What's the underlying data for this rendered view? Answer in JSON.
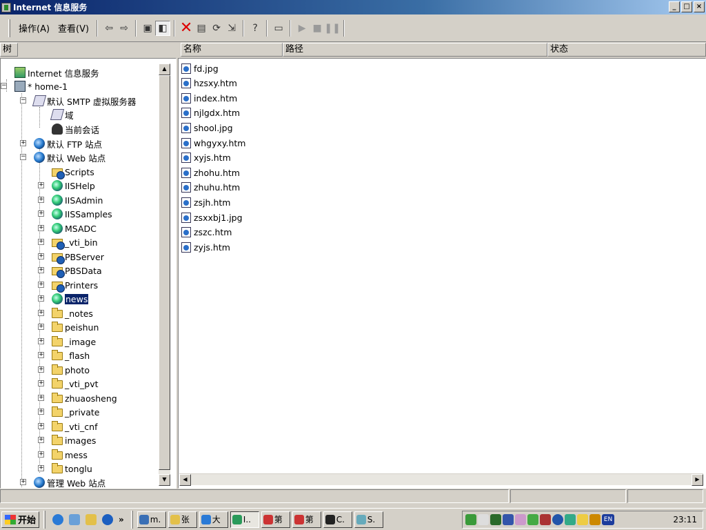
{
  "window": {
    "title": "Internet 信息服务",
    "controls": [
      "_",
      "□",
      "×"
    ]
  },
  "toolbar": {
    "menu_action": "操作(A)",
    "menu_view": "查看(V)"
  },
  "tree": {
    "header": "树",
    "nodes": [
      {
        "label": "Internet 信息服务",
        "icon": "iis-icon"
      },
      {
        "label": "* home-1",
        "icon": "computer-icon"
      },
      {
        "label": "默认 SMTP 虚拟服务器",
        "icon": "smtp-icon"
      },
      {
        "label": "域",
        "icon": "domain-icon"
      },
      {
        "label": "当前会话",
        "icon": "session-icon"
      },
      {
        "label": "默认 FTP 站点",
        "icon": "ftp-icon"
      },
      {
        "label": "默认 Web 站点",
        "icon": "web-site-icon"
      },
      {
        "label": "Scripts",
        "icon": "virtual-folder-icon"
      },
      {
        "label": "IISHelp",
        "icon": "app-icon"
      },
      {
        "label": "IISAdmin",
        "icon": "app-icon"
      },
      {
        "label": "IISSamples",
        "icon": "app-icon"
      },
      {
        "label": "MSADC",
        "icon": "app-icon"
      },
      {
        "label": "_vti_bin",
        "icon": "virtual-folder-icon"
      },
      {
        "label": "PBServer",
        "icon": "virtual-folder-icon"
      },
      {
        "label": "PBSData",
        "icon": "virtual-folder-icon"
      },
      {
        "label": "Printers",
        "icon": "virtual-folder-icon"
      },
      {
        "label": "news",
        "icon": "app-icon",
        "selected": true
      },
      {
        "label": "_notes",
        "icon": "folder-icon"
      },
      {
        "label": "peishun",
        "icon": "folder-icon"
      },
      {
        "label": "_image",
        "icon": "folder-icon"
      },
      {
        "label": "_flash",
        "icon": "folder-icon"
      },
      {
        "label": "photo",
        "icon": "folder-icon"
      },
      {
        "label": "_vti_pvt",
        "icon": "folder-icon"
      },
      {
        "label": "zhuaosheng",
        "icon": "folder-icon"
      },
      {
        "label": "_private",
        "icon": "folder-icon"
      },
      {
        "label": "_vti_cnf",
        "icon": "folder-icon"
      },
      {
        "label": "images",
        "icon": "folder-icon"
      },
      {
        "label": "mess",
        "icon": "folder-icon"
      },
      {
        "label": "tonglu",
        "icon": "folder-icon"
      },
      {
        "label": "管理 Web 站点",
        "icon": "web-site-icon"
      }
    ]
  },
  "list": {
    "columns": [
      "名称",
      "路径",
      "状态"
    ],
    "files": [
      "fd.jpg",
      "hzsxy.htm",
      "index.htm",
      "njlgdx.htm",
      "shool.jpg",
      "whgyxy.htm",
      "xyjs.htm",
      "zhohu.htm",
      "zhuhu.htm",
      "zsjh.htm",
      "zsxxbj1.jpg",
      "zszc.htm",
      "zyjs.htm"
    ]
  },
  "taskbar": {
    "start_label": "开始",
    "quick_more": "»",
    "tasks": [
      {
        "label": "m."
      },
      {
        "label": "张"
      },
      {
        "label": "大"
      },
      {
        "label": "I..",
        "active": true
      },
      {
        "label": "第"
      },
      {
        "label": "第"
      },
      {
        "label": "C."
      },
      {
        "label": "S."
      }
    ],
    "tray_language": "EN",
    "clock": "23:11"
  }
}
